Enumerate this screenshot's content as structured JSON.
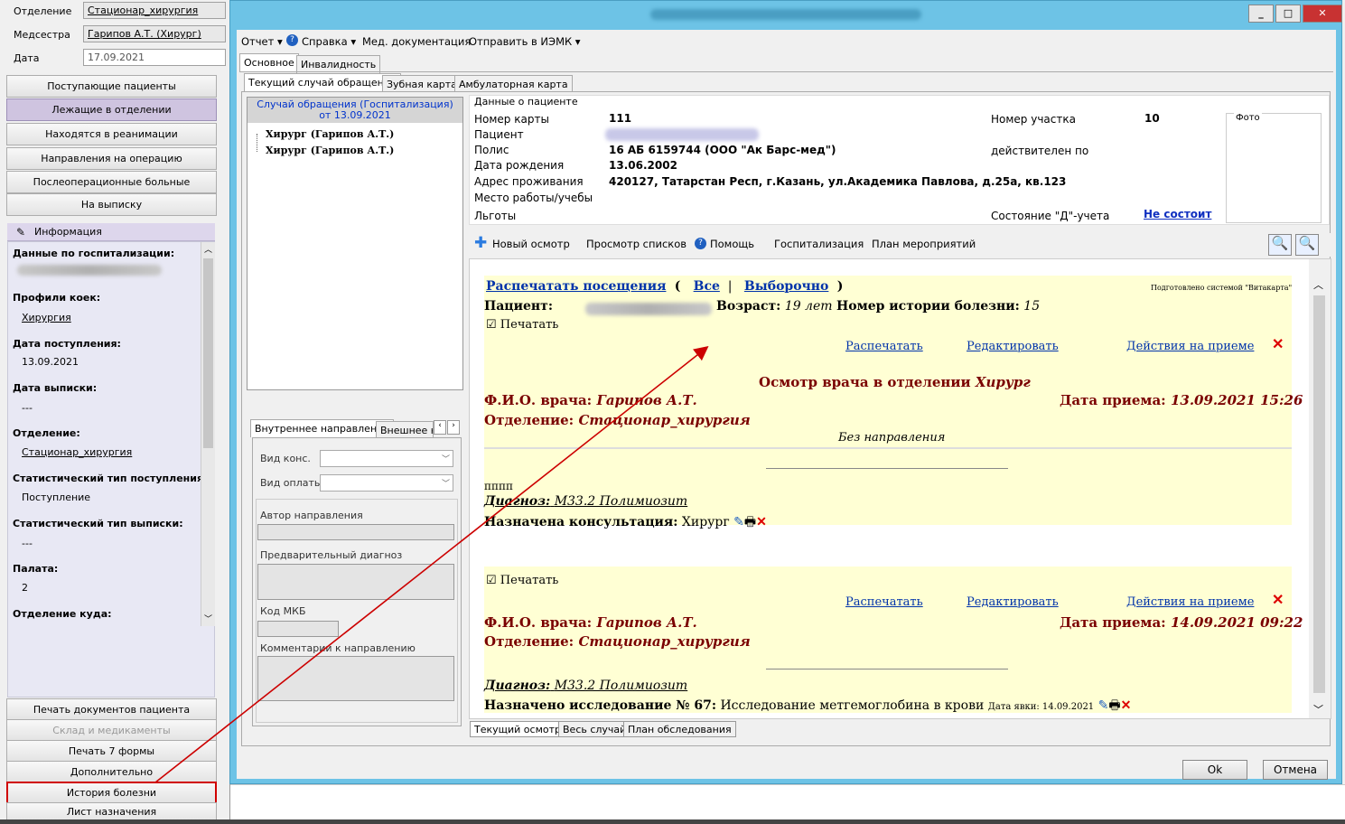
{
  "left": {
    "fields": [
      {
        "label": "Отделение",
        "value": "Стационар_хирургия"
      },
      {
        "label": "Медсестра",
        "value": "Гарипов А.Т. (Хирург)"
      },
      {
        "label": "Дата",
        "value": "17.09.2021"
      }
    ],
    "nav": [
      "Поступающие пациенты",
      "Лежащие в отделении",
      "Находятся в реанимации",
      "Направления на операцию",
      "Послеоперационные больные",
      "На выписку"
    ],
    "info_title": "Информация",
    "info": {
      "hosp_title": "Данные по госпитализации:",
      "profiles_title": "Профили коек:",
      "profiles_value": "Хирургия",
      "admit_title": "Дата поступления:",
      "admit_value": "13.09.2021",
      "discharge_title": "Дата выписки:",
      "discharge_value": "---",
      "dept_title": "Отделение:",
      "dept_value": "Стационар_хирургия",
      "stat_in_title": "Статистический тип поступления:",
      "stat_in_value": "Поступление",
      "stat_out_title": "Статистический тип выписки:",
      "stat_out_value": "---",
      "ward_title": "Палата:",
      "ward_value": "2",
      "dest_title": "Отделение куда:"
    },
    "bottom": [
      "Печать документов пациента",
      "Склад и медикаменты",
      "Печать 7 формы",
      "Дополнительно",
      "История болезни",
      "Лист назначения"
    ]
  },
  "menu": [
    "Отчет ▾",
    "Справка ▾",
    "Мед. документация",
    "Отправить в ИЭМК ▾"
  ],
  "tabs1": [
    "Основное",
    "Инвалидность"
  ],
  "tabs2": [
    "Текущий случай обращения",
    "Зубная карта",
    "Амбулаторная карта"
  ],
  "case": {
    "head1": "Случай обращения (Госпитализация)",
    "head2": "от 13.09.2021",
    "items": [
      "Хирург (Гарипов А.Т.)",
      "Хирург (Гарипов А.Т.)"
    ]
  },
  "dir": {
    "tabs": [
      "Внутреннее направление",
      "Внешнее на"
    ],
    "kind": "Вид конс.",
    "pay": "Вид оплаты",
    "author": "Автор направления",
    "prediag": "Предварительный диагноз",
    "mkb": "Код МКБ",
    "comment": "Комментарии к направлению"
  },
  "patient": {
    "group": "Данные о пациенте",
    "card_l": "Номер карты",
    "card_v": "111",
    "pat_l": "Пациент",
    "polis_l": "Полис",
    "polis_v": "16 АБ 6159744 (ООО \"Ак Барс-мед\")",
    "birth_l": "Дата рождения",
    "birth_v": "13.06.2002",
    "addr_l": "Адрес проживания",
    "addr_v": "420127, Татарстан Респ, г.Казань, ул.Академика Павлова, д.25а, кв.123",
    "work_l": "Место работы/учебы",
    "benefit_l": "Льготы",
    "area_l": "Номер участка",
    "area_v": "10",
    "valid_l": "действителен по",
    "d_l": "Состояние \"Д\"-учета",
    "d_v": "Не состоит",
    "photo": "Фото"
  },
  "toolbar": [
    "Новый осмотр",
    "Просмотр списков",
    "Помощь",
    "Госпитализация",
    "План мероприятий"
  ],
  "view": {
    "print_visits": "Распечатать посещения",
    "all": "Все",
    "selective": "Выборочно",
    "prepared": "Подготовлено системой \"Витакарта\"",
    "patient_l": "Пациент:",
    "age_l": "Возраст:",
    "age_v": "19 лет",
    "hist_l": "Номер истории болезни:",
    "hist_v": "15",
    "print_chk": "Печатать",
    "print": "Распечатать",
    "edit": "Редактировать",
    "actions": "Действия на приеме",
    "exam_title": "Осмотр врача в отделении",
    "exam_spec": "Хирург",
    "doc_l": "Ф.И.О. врача:",
    "doc_v": "Гарипов А.Т.",
    "date_l": "Дата приема:",
    "date1": "13.09.2021 15:26",
    "date2": "14.09.2021 09:22",
    "dep_l": "Отделение:",
    "dep_v": "Стационар_хирургия",
    "no_dir": "Без направления",
    "note": "пппп",
    "diag_l": "Диагноз:",
    "diag_v": "М33.2 Полимиозит",
    "consult_l": "Назначена консультация:",
    "consult_v": "Хирург",
    "study_l": "Назначено исследование № 67:",
    "study_v": "Исследование метгемоглобина в крови",
    "study_date": "Дата явки: 14.09.2021"
  },
  "bottom_tabs": [
    "Текущий осмотр",
    "Весь случай",
    "План обследования"
  ],
  "buttons": {
    "ok": "Ok",
    "cancel": "Отмена"
  }
}
